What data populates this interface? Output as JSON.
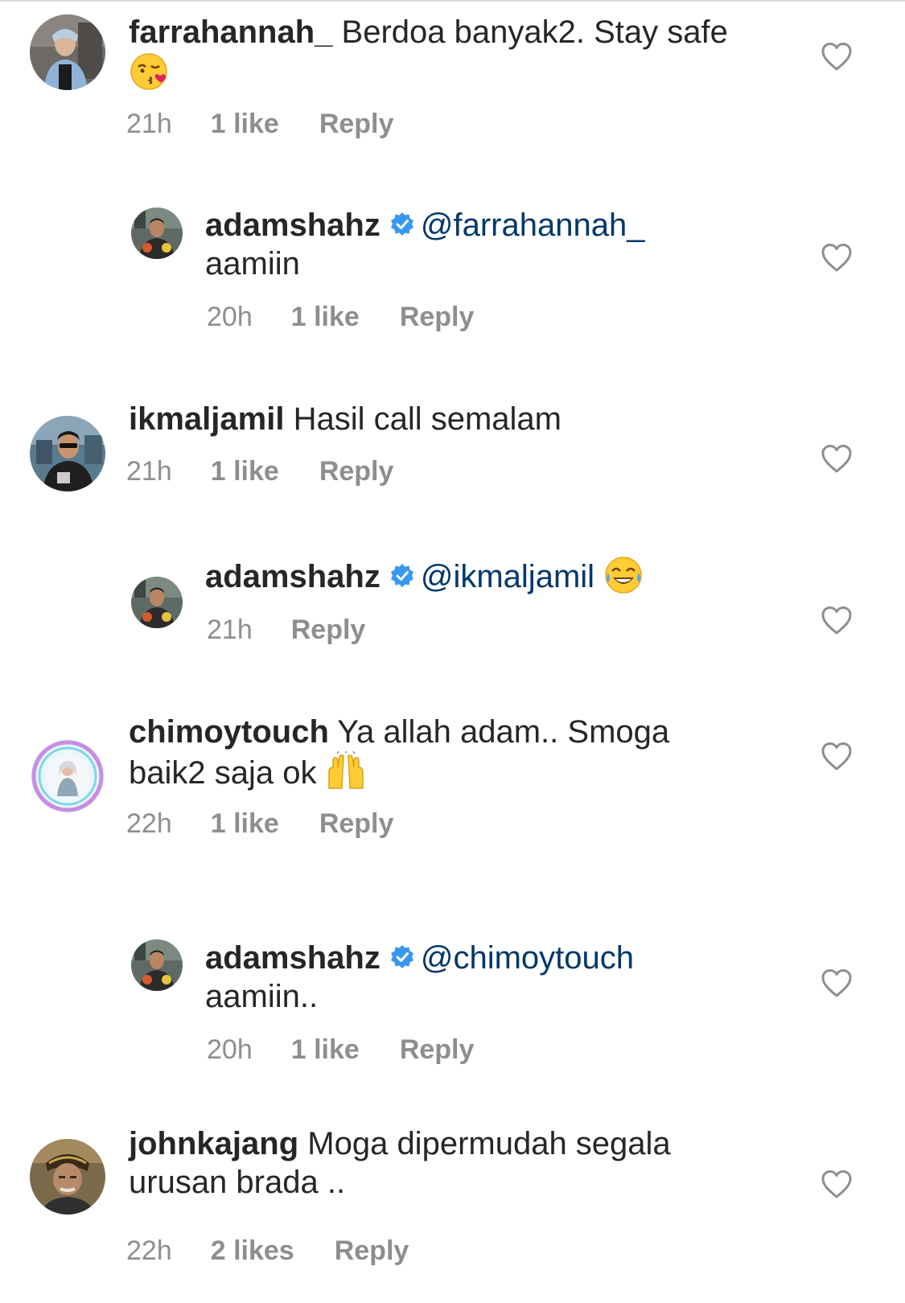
{
  "colors": {
    "text": "#262626",
    "muted": "#8e8e8e",
    "mention": "#00376b",
    "verified": "#3897f0"
  },
  "comments": [
    {
      "username": "farrahannah_",
      "text": "Berdoa banyak2. Stay safe",
      "emoji": "kissing-heart-emoji",
      "time": "21h",
      "likes": "1 like",
      "reply": "Reply",
      "heart_icon": "heart-outline-icon"
    },
    {
      "username": "adamshahz",
      "mention": "@farrahannah_",
      "text": "aamiin",
      "time": "20h",
      "likes": "1 like",
      "reply": "Reply",
      "verified_icon": "verified-badge-icon",
      "heart_icon": "heart-outline-icon"
    },
    {
      "username": "ikmaljamil",
      "text": "Hasil call semalam",
      "time": "21h",
      "likes": "1 like",
      "reply": "Reply",
      "heart_icon": "heart-outline-icon"
    },
    {
      "username": "adamshahz",
      "mention": "@ikmaljamil",
      "emoji": "tears-of-joy-emoji",
      "time": "21h",
      "reply": "Reply",
      "verified_icon": "verified-badge-icon",
      "heart_icon": "heart-outline-icon"
    },
    {
      "username": "chimoytouch",
      "text_line1": "Ya allah adam.. Smoga",
      "text_line2": "baik2 saja ok",
      "emoji": "raising-hands-emoji",
      "time": "22h",
      "likes": "1 like",
      "reply": "Reply",
      "heart_icon": "heart-outline-icon"
    },
    {
      "username": "adamshahz",
      "mention": "@chimoytouch",
      "text": "aamiin..",
      "time": "20h",
      "likes": "1 like",
      "reply": "Reply",
      "verified_icon": "verified-badge-icon",
      "heart_icon": "heart-outline-icon"
    },
    {
      "username": "johnkajang",
      "text_line1": "Moga dipermudah segala",
      "text_line2": "urusan brada ..",
      "time": "22h",
      "likes": "2 likes",
      "reply": "Reply",
      "heart_icon": "heart-outline-icon"
    }
  ]
}
